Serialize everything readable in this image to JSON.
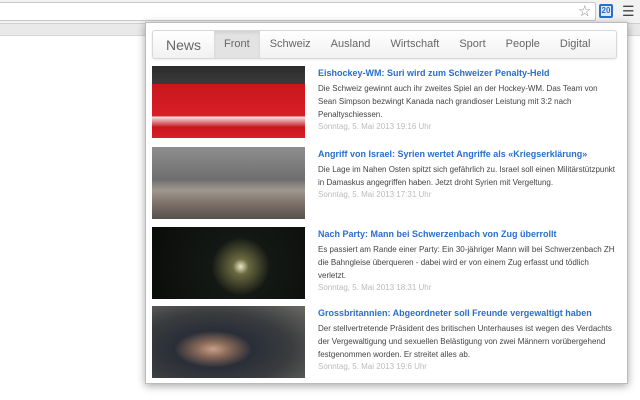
{
  "browser": {
    "star_icon": "star-icon",
    "extension_icon": "news-extension-icon",
    "menu_icon": "hamburger-menu-icon"
  },
  "popup": {
    "brand": "News",
    "tabs": [
      {
        "label": "Front",
        "active": true
      },
      {
        "label": "Schweiz"
      },
      {
        "label": "Ausland"
      },
      {
        "label": "Wirtschaft"
      },
      {
        "label": "Sport"
      },
      {
        "label": "People"
      },
      {
        "label": "Digital"
      }
    ],
    "articles": [
      {
        "title": "Eishockey-WM: Suri wird zum Schweizer Penalty-Held",
        "lead": "Die Schweiz gewinnt auch ihr zweites Spiel an der Hockey-WM. Das Team von Sean Simpson bezwingt Kanada nach grandioser Leistung mit 3:2 nach Penaltyschiessen.",
        "date": "Sonntag, 5. Mai 2013 19:16 Uhr"
      },
      {
        "title": "Angriff von Israel: Syrien wertet Angriffe als «Kriegserklärung»",
        "lead": "Die Lage im Nahen Osten spitzt sich gefährlich zu. Israel soll einen Militärstützpunkt in Damaskus angegriffen haben. Jetzt droht Syrien mit Vergeltung.",
        "date": "Sonntag, 5. Mai 2013 17:31 Uhr"
      },
      {
        "title": "Nach Party: Mann bei Schwerzenbach von Zug überrollt",
        "lead": "Es passiert am Rande einer Party: Ein 30-jähriger Mann will bei Schwerzenbach ZH die Bahngleise überqueren - dabei wird er von einem Zug erfasst und tödlich verletzt.",
        "date": "Sonntag, 5. Mai 2013 18:31 Uhr"
      },
      {
        "title": "Grossbritannien: Abgeordneter soll Freunde vergewaltigt haben",
        "lead": "Der stellvertretende Präsident des britischen Unterhauses ist wegen des Verdachts der Vergewaltigung und sexuellen Belästigung von zwei Männern vorübergehend festgenommen worden. Er streitet alles ab.",
        "date": "Sonntag, 5. Mai 2013 19:6 Uhr"
      }
    ]
  }
}
